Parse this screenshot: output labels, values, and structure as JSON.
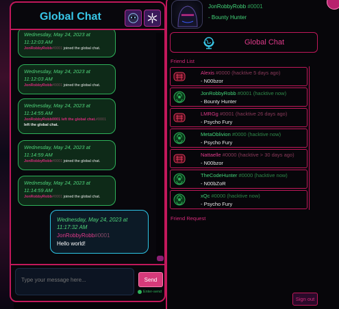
{
  "header": {
    "title": "Global Chat"
  },
  "messages": [
    {
      "timestamp": "Wednesday, May 24, 2023 at 11:12:03 AM",
      "name": "JonRobbyRobb",
      "tag": "#0001",
      "action": " joined the global chat."
    },
    {
      "timestamp": "Wednesday, May 24, 2023 at 11:12:03 AM",
      "name": "JonRobbyRobb",
      "tag": "#0001",
      "action": " joined the global chat."
    },
    {
      "timestamp": "Wednesday, May 24, 2023 at 11:14:55 AM",
      "name": "JonRobbyRobb0001 left the global chat.",
      "tag": "#0001",
      "action": "left the global chat."
    },
    {
      "timestamp": "Wednesday, May 24, 2023 at 11:14:59 AM",
      "name": "JonRobbyRobb",
      "tag": "#0001",
      "action": " joined the global chat."
    },
    {
      "timestamp": "Wednesday, May 24, 2023 at 11:14:59 AM",
      "name": "JonRobbyRobb",
      "tag": "#0001",
      "action": " joined the global chat."
    }
  ],
  "my_message": {
    "timestamp": "Wednesday, May 24, 2023 at 11:17:32 AM",
    "name": "JonRobbyRobb",
    "tag": "#0001",
    "text": "Hello world!"
  },
  "composer": {
    "placeholder": "Type your message here...",
    "send_label": "Send",
    "enter_send_label": "Enter-send"
  },
  "profile": {
    "name": "JonRobbyRobb",
    "tag": "#0001",
    "title": "- Bounty Hunter"
  },
  "global_chat_button": {
    "label": "Global Chat"
  },
  "friend_list": {
    "label": "Friend List",
    "friends": [
      {
        "name": "Alexis",
        "tag": "#0000",
        "status": "(hacktive 5 days ago)",
        "title": "- N00bzor",
        "online": false
      },
      {
        "name": "JonRobbyRobb",
        "tag": "#0001",
        "status": "(hacktive now)",
        "title": "- Bounty Hunter",
        "online": true
      },
      {
        "name": "LMRGg",
        "tag": "#0001",
        "status": "(hacktive 26 days ago)",
        "title": "- Psycho Fury",
        "online": false
      },
      {
        "name": "MetaOblivion",
        "tag": "#0000",
        "status": "(hacktive now)",
        "title": "- Psycho Fury",
        "online": true
      },
      {
        "name": "Nattaelle",
        "tag": "#0000",
        "status": "(hacktive > 30 days ago)",
        "title": "- N00bzor",
        "online": false
      },
      {
        "name": "TheCodeHunter",
        "tag": "#0000",
        "status": "(hacktive now)",
        "title": "- N00bZoR",
        "online": true
      },
      {
        "name": "xQc",
        "tag": "#0000",
        "status": "(hacktive now)",
        "title": "- Psycho Fury",
        "online": true
      }
    ]
  },
  "friend_request": {
    "label": "Friend Request"
  },
  "signout": {
    "label": "Sign out"
  },
  "colors": {
    "accent_pink": "#c2185b",
    "online_green": "#43d67a",
    "cyan": "#38c7e8"
  }
}
